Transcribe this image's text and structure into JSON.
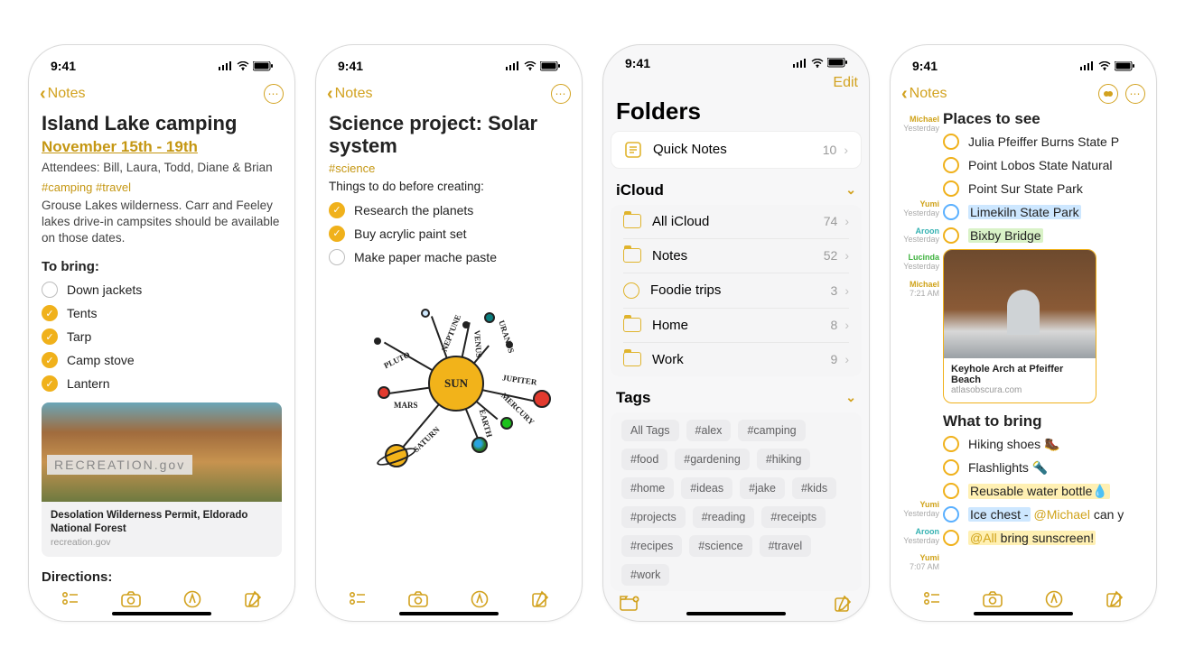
{
  "status": {
    "time": "9:41"
  },
  "nav": {
    "back": "Notes",
    "edit": "Edit"
  },
  "phone1": {
    "title": "Island Lake camping",
    "date_link": "November 15th - 19th",
    "attendees": "Attendees:  Bill, Laura, Todd, Diane & Brian",
    "tags": "#camping #travel",
    "body": "Grouse Lakes wilderness. Carr and Feeley lakes drive-in campsites should be available on those dates.",
    "bring_h": "To bring:",
    "items": [
      "Down jackets",
      "Tents",
      "Tarp",
      "Camp stove",
      "Lantern"
    ],
    "card": {
      "banner": "RECREATION.gov",
      "title": "Desolation Wilderness Permit, Eldorado National Forest",
      "source": "recreation.gov"
    },
    "directions_h": "Directions:"
  },
  "phone2": {
    "title": "Science project: Solar system",
    "tag": "#science",
    "sub": "Things to do before creating:",
    "tasks": [
      "Research the planets",
      "Buy acrylic paint set",
      "Make paper mache paste"
    ],
    "planets": [
      "MERCURY",
      "VENUS",
      "EARTH",
      "MARS",
      "JUPITER",
      "SATURN",
      "URANUS",
      "NEPTUNE",
      "PLUTO"
    ],
    "center": "SUN"
  },
  "phone3": {
    "title": "Folders",
    "quick": {
      "label": "Quick Notes",
      "count": "10"
    },
    "section_icloud": "iCloud",
    "folders": [
      {
        "name": "All iCloud",
        "count": "74"
      },
      {
        "name": "Notes",
        "count": "52"
      },
      {
        "name": "Foodie trips",
        "count": "3",
        "gear": true
      },
      {
        "name": "Home",
        "count": "8"
      },
      {
        "name": "Work",
        "count": "9"
      }
    ],
    "section_tags": "Tags",
    "tags": [
      "All Tags",
      "#alex",
      "#camping",
      "#food",
      "#gardening",
      "#hiking",
      "#home",
      "#ideas",
      "#jake",
      "#kids",
      "#projects",
      "#reading",
      "#receipts",
      "#recipes",
      "#science",
      "#travel",
      "#work"
    ]
  },
  "phone4": {
    "title1": "Places to see",
    "places": [
      "Julia Pfeiffer Burns State P",
      "Point Lobos State Natural ",
      "Point Sur State Park",
      "Limekiln State Park",
      "Bixby Bridge"
    ],
    "attach": {
      "title": "Keyhole Arch at Pfeiffer Beach",
      "source": "atlasobscura.com"
    },
    "title2": "What to bring",
    "bring": [
      "Hiking shoes 🥾",
      "Flashlights 🔦",
      "Reusable water bottle💧",
      "Ice chest - @Michael can y",
      "@All bring sunscreen!"
    ],
    "gutter": [
      {
        "name": "Michael",
        "time": "Yesterday",
        "class": "name"
      },
      {
        "name": "Yumi",
        "time": "Yesterday",
        "class": "name"
      },
      {
        "name": "Aroon",
        "time": "Yesterday",
        "class": "name teal"
      },
      {
        "name": "Lucinda",
        "time": "Yesterday",
        "class": "name green"
      },
      {
        "name": "Michael",
        "time": "7:21 AM",
        "class": "name"
      },
      {
        "name": "Yumi",
        "time": "Yesterday",
        "class": "name"
      },
      {
        "name": "Aroon",
        "time": "Yesterday",
        "class": "name teal"
      },
      {
        "name": "Yumi",
        "time": "7:07 AM",
        "class": "name"
      }
    ]
  }
}
